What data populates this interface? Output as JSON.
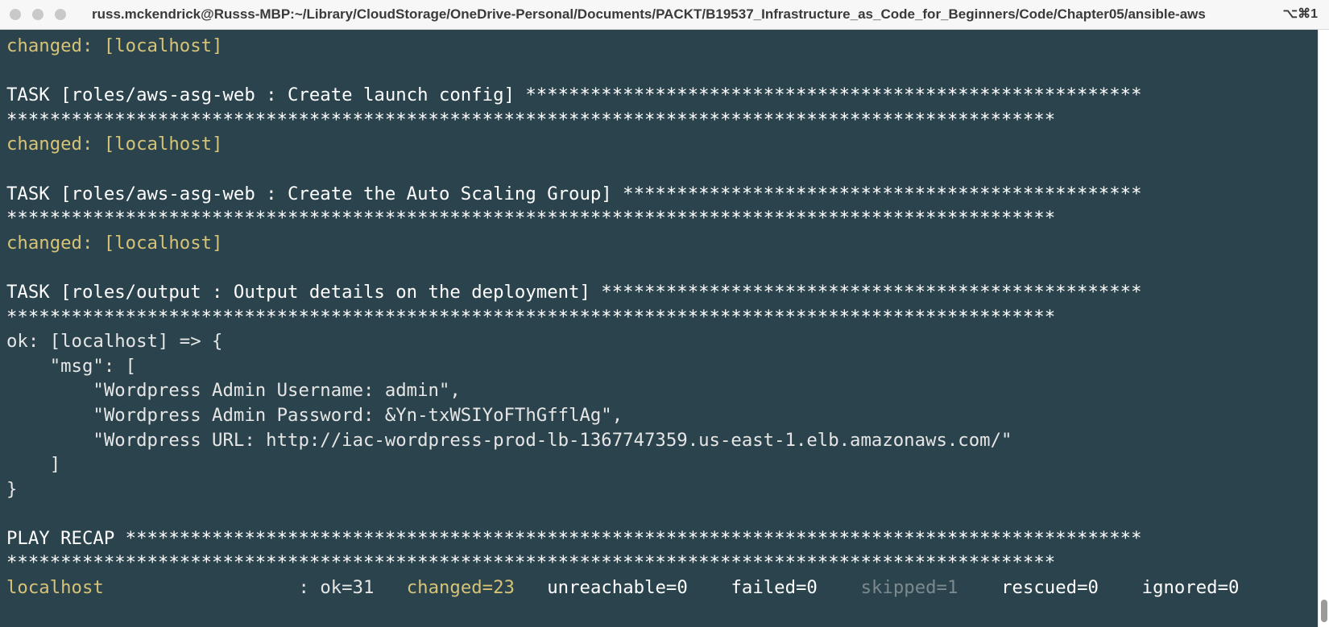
{
  "window": {
    "title": "russ.mckendrick@Russs-MBP:~/Library/CloudStorage/OneDrive-Personal/Documents/PACKT/B19537_Infrastructure_as_Code_for_Beginners/Code/Chapter05/ansible-aws",
    "shortcut": "⌥⌘1"
  },
  "terminal": {
    "lines": [
      {
        "text": "changed: [localhost]",
        "style": "yellow"
      },
      {
        "text": "",
        "style": ""
      },
      {
        "text": "TASK [roles/aws-asg-web : Create launch config] *********************************************************",
        "style": "white"
      },
      {
        "text": "*************************************************************************************************",
        "style": "white"
      },
      {
        "text": "changed: [localhost]",
        "style": "yellow"
      },
      {
        "text": "",
        "style": ""
      },
      {
        "text": "TASK [roles/aws-asg-web : Create the Auto Scaling Group] ************************************************",
        "style": "white"
      },
      {
        "text": "*************************************************************************************************",
        "style": "white"
      },
      {
        "text": "changed: [localhost]",
        "style": "yellow"
      },
      {
        "text": "",
        "style": ""
      },
      {
        "text": "TASK [roles/output : Output details on the deployment] **************************************************",
        "style": "white"
      },
      {
        "text": "*************************************************************************************************",
        "style": "white"
      },
      {
        "text": "ok: [localhost] => {",
        "style": ""
      },
      {
        "text": "    \"msg\": [",
        "style": ""
      },
      {
        "text": "        \"Wordpress Admin Username: admin\",",
        "style": ""
      },
      {
        "text": "        \"Wordpress Admin Password: &Yn-txWSIYoFThGfflAg\",",
        "style": ""
      },
      {
        "text": "        \"Wordpress URL: http://iac-wordpress-prod-lb-1367747359.us-east-1.elb.amazonaws.com/\"",
        "style": ""
      },
      {
        "text": "    ]",
        "style": ""
      },
      {
        "text": "}",
        "style": ""
      },
      {
        "text": "",
        "style": ""
      },
      {
        "text": "PLAY RECAP **********************************************************************************************",
        "style": "white"
      }
    ],
    "recap_wrap": "*************************************************************************************************",
    "recap": {
      "host": "localhost",
      "sep": "                  : ",
      "ok": "ok=31",
      "changed": "changed=23",
      "unreachable": "unreachable=0",
      "failed": "failed=0",
      "skipped": "skipped=1",
      "rescued": "rescued=0",
      "ignored": "ignored=0"
    }
  },
  "colors": {
    "background": "#2b434c",
    "changed": "#d6c377",
    "text": "#e6e6e6",
    "skipped": "#7b8a8e"
  }
}
